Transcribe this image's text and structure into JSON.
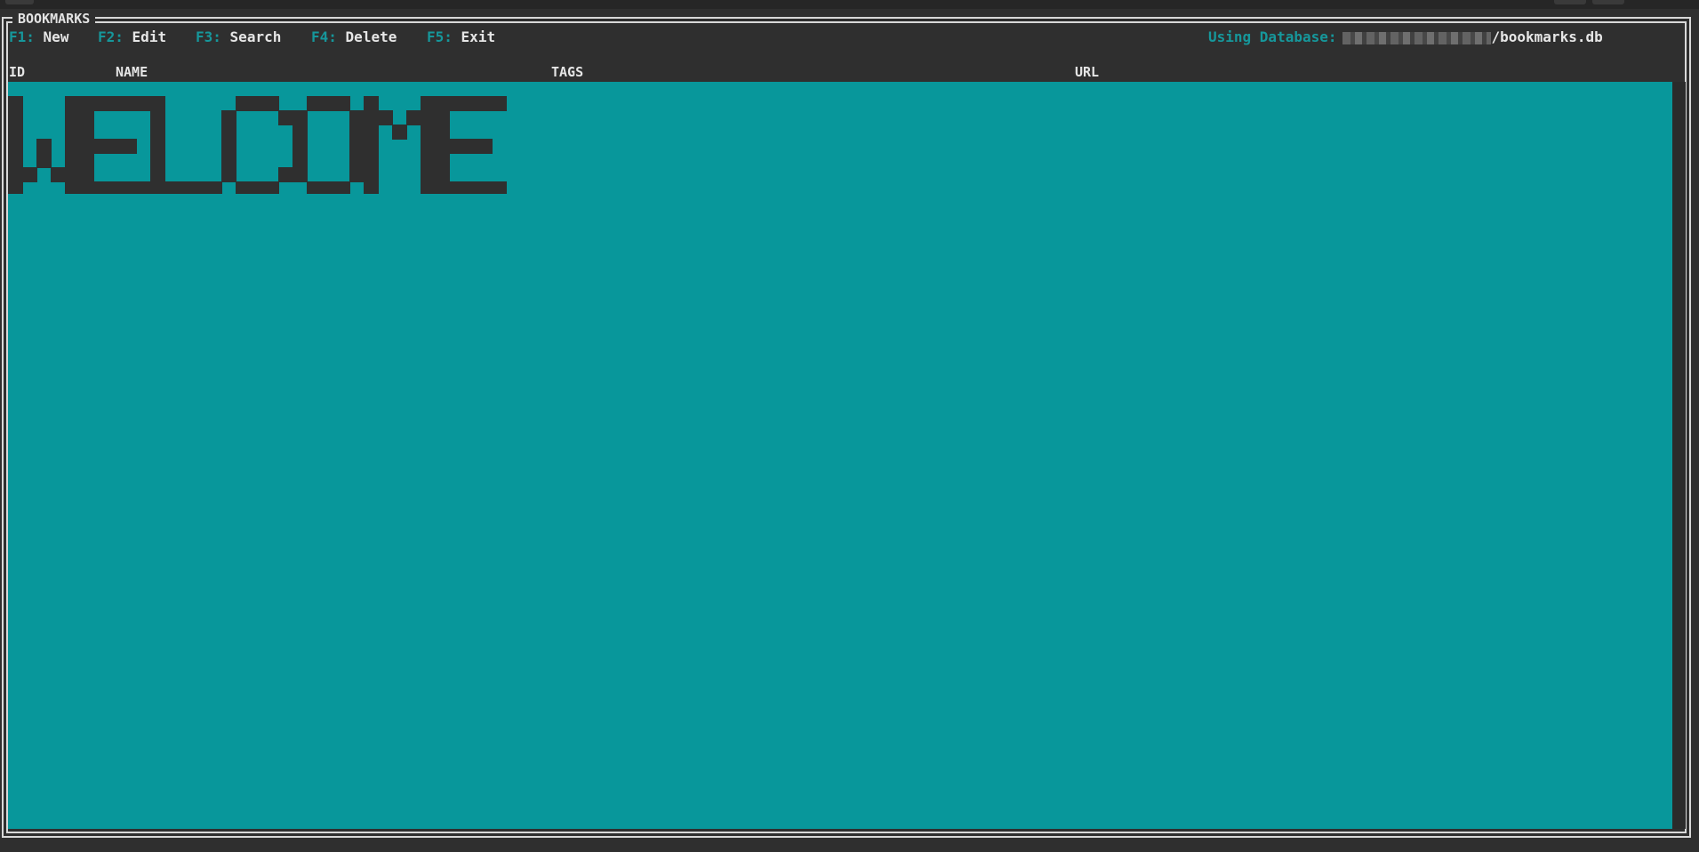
{
  "window": {
    "title": "BOOKMARKS"
  },
  "toolbar": {
    "items": [
      {
        "key": "F1:",
        "label": "New"
      },
      {
        "key": "F2:",
        "label": "Edit"
      },
      {
        "key": "F3:",
        "label": "Search"
      },
      {
        "key": "F4:",
        "label": "Delete"
      },
      {
        "key": "F5:",
        "label": "Exit"
      }
    ]
  },
  "database": {
    "label": "Using Database:",
    "path_suffix": "/bookmarks.db"
  },
  "table": {
    "columns": [
      "ID",
      "NAME",
      "TAGS",
      "URL"
    ]
  },
  "banner": {
    "text": "WELCOME"
  },
  "colors": {
    "accent": "#16979b",
    "content_bg": "#08979b",
    "window_bg": "#2f2f2f",
    "text": "#e6e6e6",
    "banner": "#2f2f2f"
  }
}
